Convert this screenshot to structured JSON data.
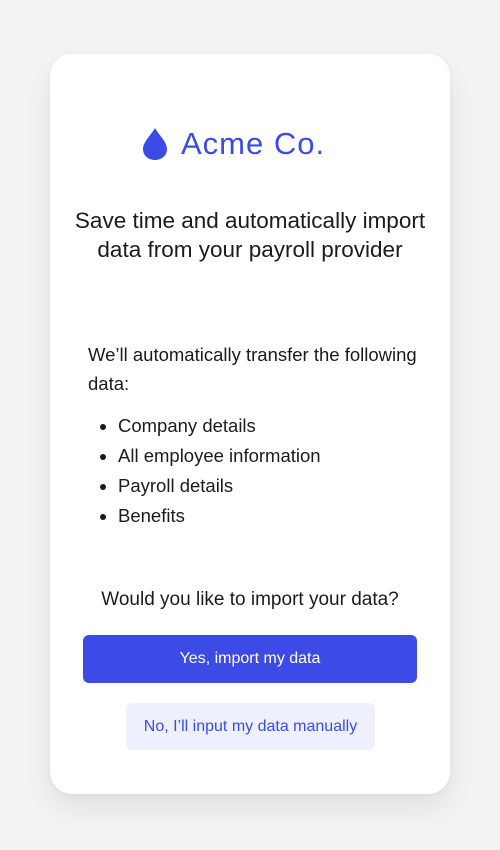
{
  "brand": {
    "name": "Acme Co.",
    "icon": "drop-icon",
    "color": "#3c4be6"
  },
  "headline": "Save time and automatically import data from your payroll provider",
  "intro": "We’ll automatically transfer the following data:",
  "data_items": [
    "Company details",
    "All employee information",
    "Payroll details",
    "Benefits"
  ],
  "question": "Would you like to import your data?",
  "actions": {
    "primary_label": "Yes, import my data",
    "secondary_label": "No, I’ll input my data manually"
  }
}
